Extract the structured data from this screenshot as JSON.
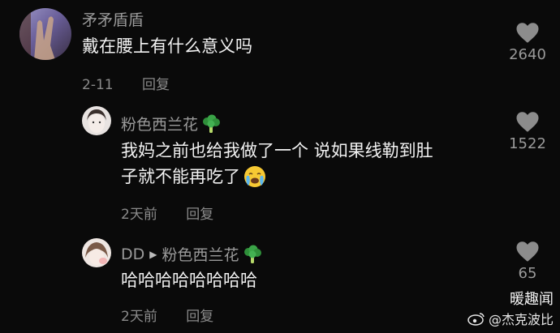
{
  "comments": [
    {
      "username": "矛矛盾盾",
      "content": "戴在腰上有什么意义吗",
      "date": "2-11",
      "reply_label": "回复",
      "likes": "2640"
    },
    {
      "username": "粉色西兰花",
      "username_emoji": "broccoli-icon",
      "content_line1": "我妈之前也给我做了一个 说如果线勒到肚",
      "content_line2": "子就不能再吃了",
      "content_emoji": "crying-face-icon",
      "date": "2天前",
      "reply_label": "回复",
      "likes": "1522"
    },
    {
      "username": "DD",
      "reply_to": "粉色西兰花",
      "reply_to_emoji": "broccoli-icon",
      "content": "哈哈哈哈哈哈哈哈",
      "date": "2天前",
      "reply_label": "回复",
      "likes": "65"
    }
  ],
  "watermark": {
    "title": "暖趣闻",
    "account": "@杰克波比"
  },
  "colors": {
    "background": "#0a0a0a",
    "secondary_text": "#9a9a9a",
    "heart": "#8c8c8c"
  }
}
